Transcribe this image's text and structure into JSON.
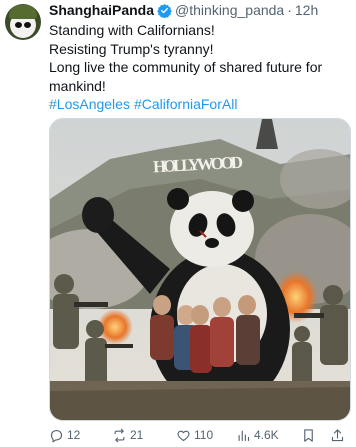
{
  "post": {
    "display_name": "ShanghaiPanda",
    "handle": "@thinking_panda",
    "separator": "·",
    "time": "12h",
    "lines": [
      "Standing with Californians!",
      "Resisting Trump's tyranny!",
      "Long live the community of shared future for",
      "mankind!"
    ],
    "hashtags": [
      "#LosAngeles",
      "#CaliforniaForAll"
    ],
    "image_sign_text": "HOLLYWOOD"
  },
  "actions": {
    "replies": "12",
    "reposts": "21",
    "likes": "110",
    "views": "4.6K"
  },
  "colors": {
    "text": "#0f1419",
    "secondary": "#536471",
    "link": "#1d9bf0",
    "verified": "#1d9bf0"
  },
  "icons": [
    "reply-icon",
    "repost-icon",
    "like-icon",
    "views-icon",
    "bookmark-icon",
    "share-icon",
    "verified-badge-icon"
  ]
}
